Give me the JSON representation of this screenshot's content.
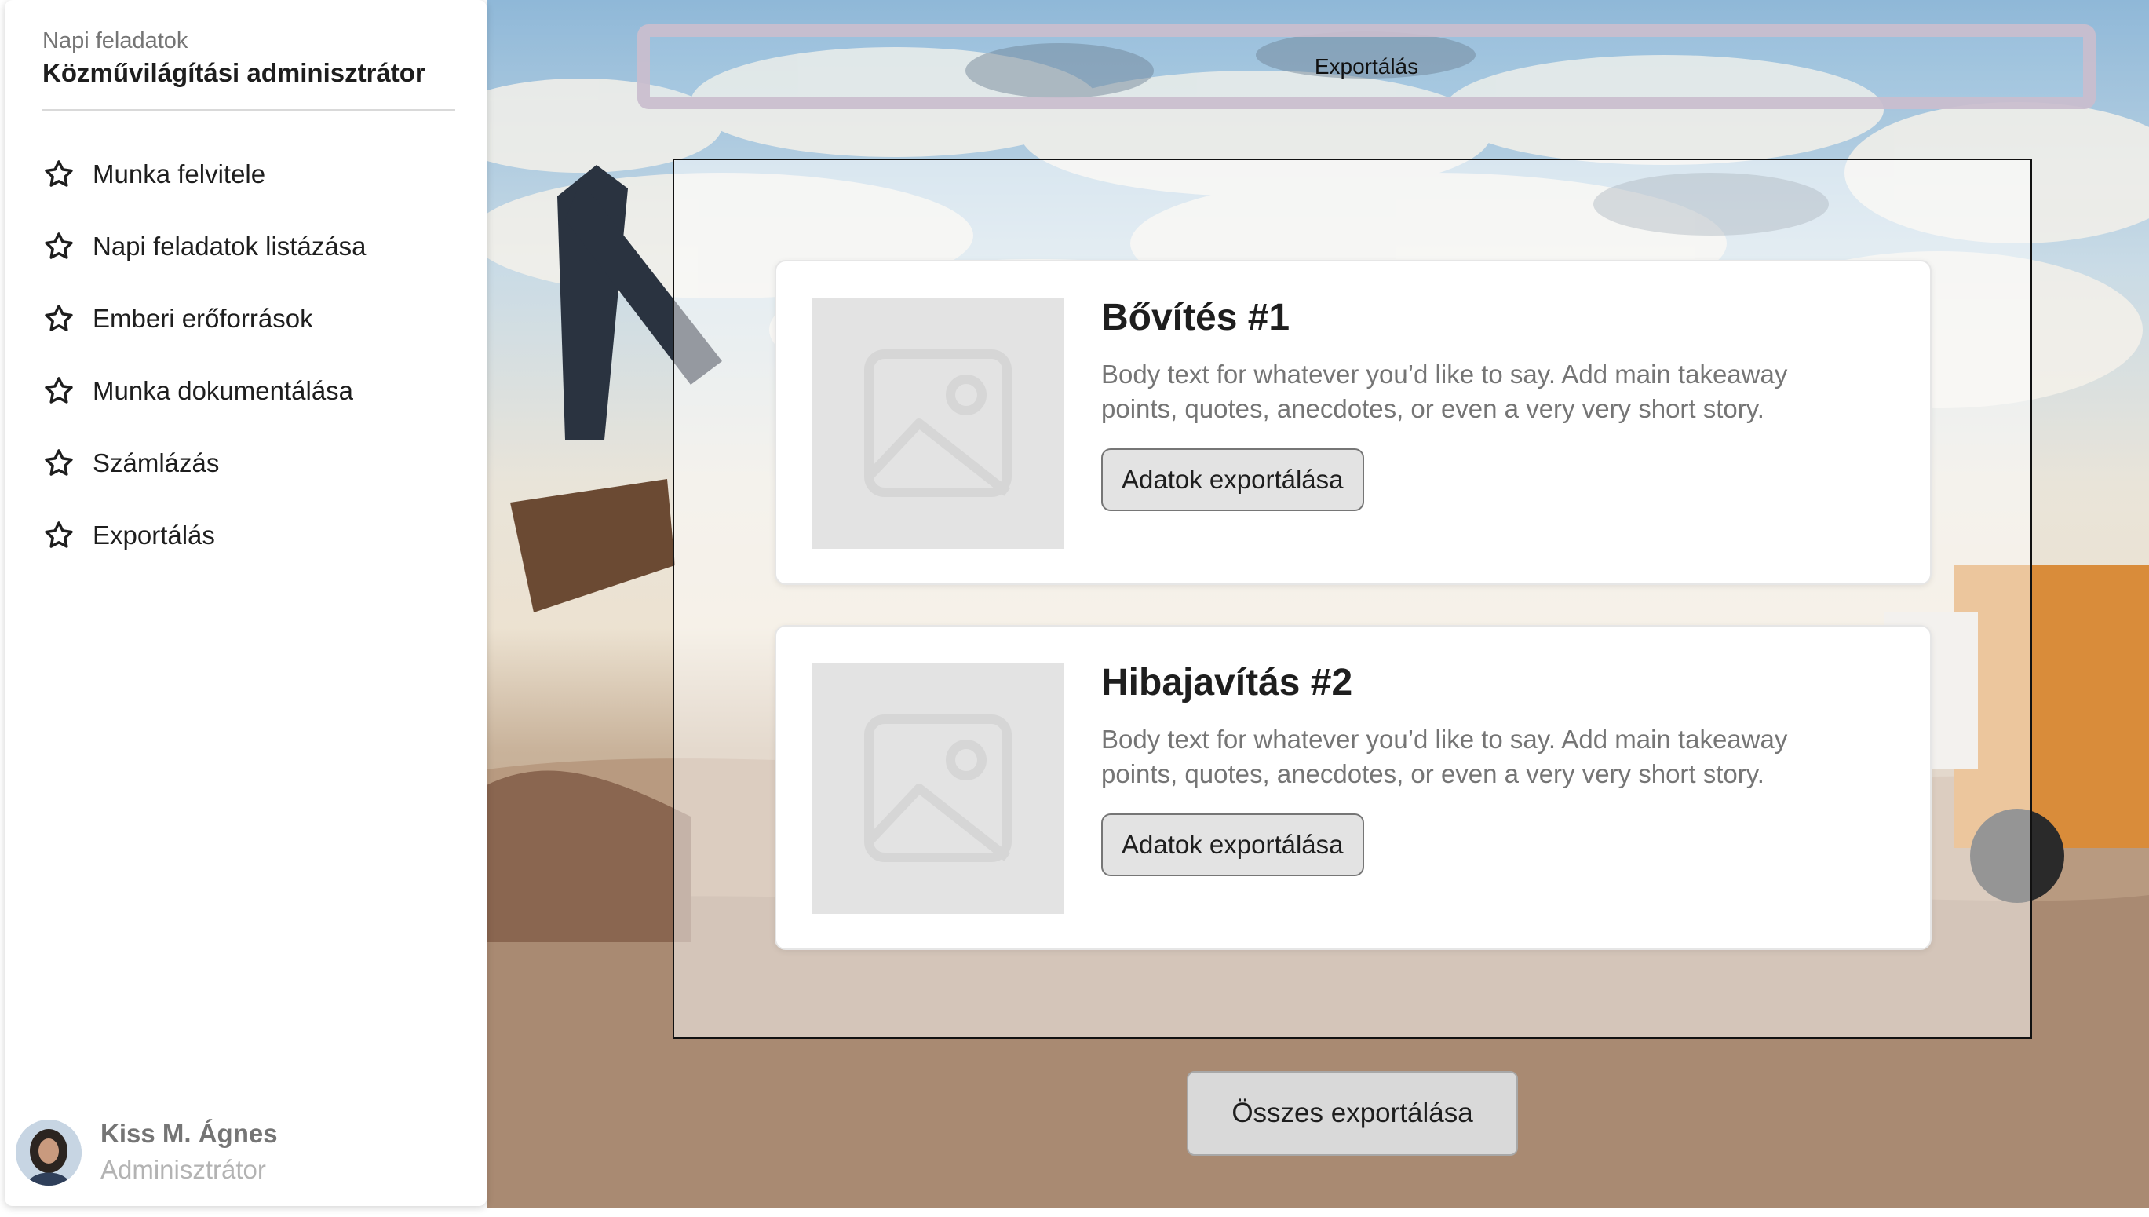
{
  "sidebar": {
    "kicker": "Napi feladatok",
    "title": "Közművilágítási adminisztrátor",
    "items": [
      {
        "label": "Munka felvitele",
        "icon": "star-icon"
      },
      {
        "label": "Napi feladatok listázása",
        "icon": "star-icon"
      },
      {
        "label": "Emberi erőforrások",
        "icon": "star-icon"
      },
      {
        "label": "Munka dokumentálása",
        "icon": "star-icon"
      },
      {
        "label": "Számlázás",
        "icon": "star-icon"
      },
      {
        "label": "Exportálás",
        "icon": "star-icon"
      }
    ],
    "user": {
      "name": "Kiss M. Ágnes",
      "role": "Adminisztrátor"
    }
  },
  "header": {
    "title": "Exportálás"
  },
  "cards": [
    {
      "title": "Bővítés #1",
      "body": "Body text for whatever you’d like to say. Add main takeaway points, quotes, anecdotes, or even a very very short story.",
      "button": "Adatok exportálása",
      "image_icon": "image-placeholder-icon"
    },
    {
      "title": "Hibajavítás #2",
      "body": "Body text for whatever you’d like to say. Add main takeaway points, quotes, anecdotes, or even a very very short story.",
      "button": "Adatok exportálása",
      "image_icon": "image-placeholder-icon"
    }
  ],
  "footer": {
    "export_all": "Összes exportálása"
  },
  "colors": {
    "text_primary": "#1e1e1e",
    "text_secondary": "#757575",
    "text_muted": "#b3b3b3",
    "placeholder": "#e3e3e3",
    "header_border": "#cabece"
  }
}
